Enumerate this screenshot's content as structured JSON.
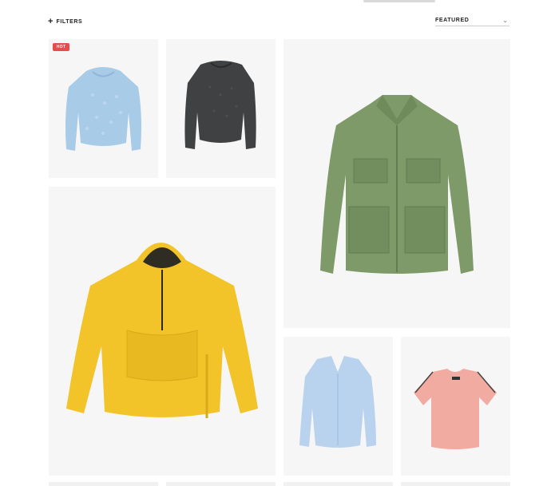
{
  "toolbar": {
    "filters_label": "FILTERS",
    "filters_icon": "plus-icon",
    "sort_value": "FEATURED",
    "sort_icon": "chevron-down-icon"
  },
  "products": [
    {
      "name": "light-blue-knit-sweater",
      "badge": "HOT",
      "color": "#a8cbe8"
    },
    {
      "name": "charcoal-knit-sweater",
      "color": "#3f4142"
    },
    {
      "name": "olive-green-utility-jacket",
      "color": "#7e9a68"
    },
    {
      "name": "yellow-hooded-anorak",
      "color": "#f2c42a"
    },
    {
      "name": "pale-blue-v-neck-sweater",
      "color": "#b9d3ee"
    },
    {
      "name": "pink-knit-tee",
      "color": "#f2aba1"
    }
  ],
  "colors": {
    "card_bg": "#f6f6f7",
    "badge_bg": "#e84b4b"
  }
}
